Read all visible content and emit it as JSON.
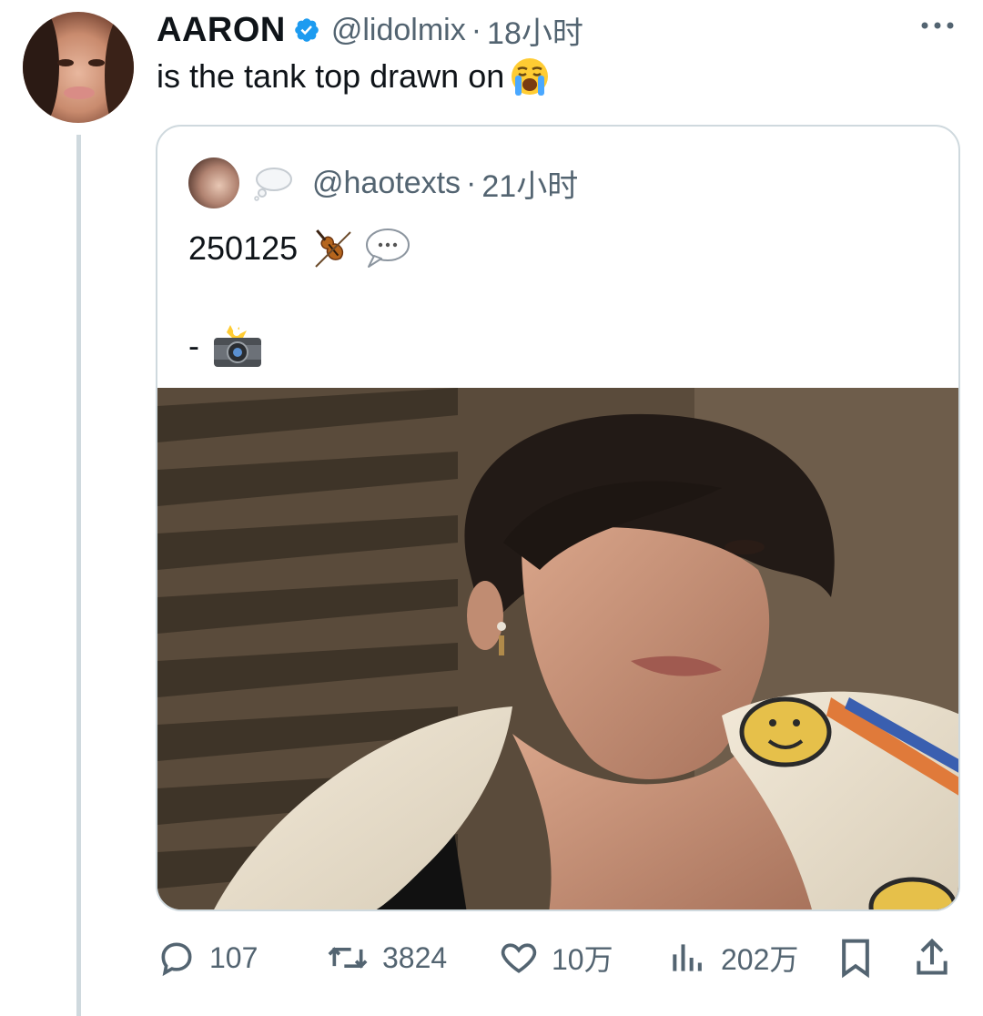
{
  "tweet": {
    "author_name": "AARON",
    "handle": "@lidolmix",
    "separator": "·",
    "time": "18小时",
    "text": "is the tank top drawn on",
    "emoji": "loudly-crying-face"
  },
  "quoted_tweet": {
    "author_display_emoji": "thought-balloon",
    "handle": "@haotexts",
    "separator": "·",
    "time": "21小时",
    "line1": "250125",
    "line1_emojis": [
      "violin",
      "speech-balloon"
    ],
    "line2": "-",
    "line2_emoji": "camera-with-flash",
    "image_description_icon": "photo"
  },
  "actions": {
    "replies": "107",
    "retweets": "3824",
    "likes": "10万",
    "views": "202万"
  },
  "colors": {
    "text_primary": "#0f1419",
    "text_secondary": "#536471",
    "border": "#cfd9de",
    "verified": "#1d9bf0"
  }
}
